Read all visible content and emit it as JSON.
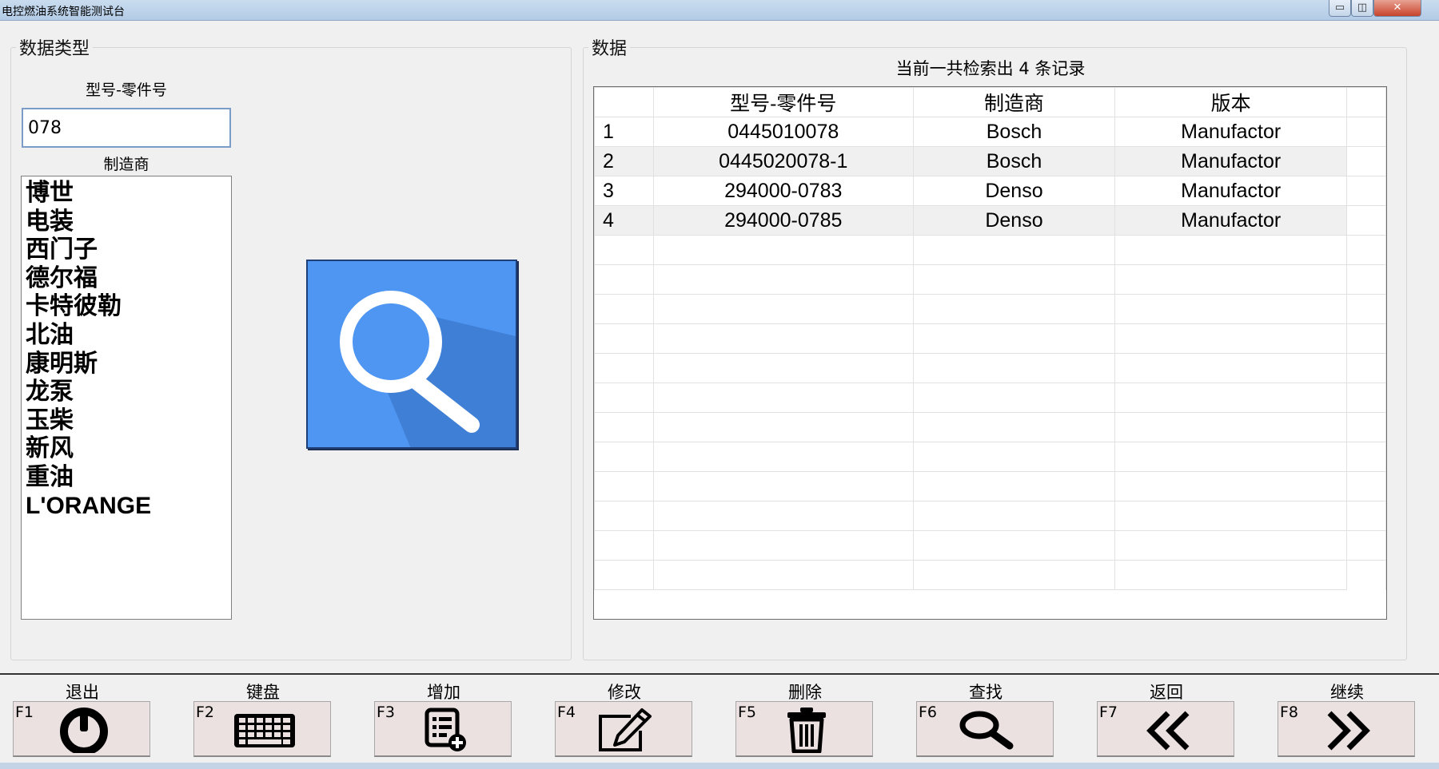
{
  "window": {
    "title": "电控燃油系统智能测试台",
    "min_label": "▭",
    "max_label": "◫",
    "close_label": "✕"
  },
  "left_panel": {
    "legend": "数据类型",
    "part_label": "型号-零件号",
    "part_value": "078",
    "manufacturer_label": "制造商",
    "manufacturers": [
      "博世",
      "电装",
      "西门子",
      "德尔福",
      "卡特彼勒",
      "北油",
      "康明斯",
      "龙泵",
      "玉柴",
      "新风",
      "重油",
      "L'ORANGE"
    ]
  },
  "search_button_icon": "search-icon",
  "right_panel": {
    "legend": "数据",
    "count_text": "当前一共检索出 4 条记录",
    "columns": [
      "",
      "型号-零件号",
      "制造商",
      "版本"
    ],
    "rows": [
      [
        "1",
        "0445010078",
        "Bosch",
        "Manufactor"
      ],
      [
        "2",
        "0445020078-1",
        "Bosch",
        "Manufactor"
      ],
      [
        "3",
        "294000-0783",
        "Denso",
        "Manufactor"
      ],
      [
        "4",
        "294000-0785",
        "Denso",
        "Manufactor"
      ]
    ]
  },
  "function_keys": [
    {
      "key": "F1",
      "label": "退出",
      "icon": "power-icon"
    },
    {
      "key": "F2",
      "label": "键盘",
      "icon": "keyboard-icon"
    },
    {
      "key": "F3",
      "label": "增加",
      "icon": "add-list-icon"
    },
    {
      "key": "F4",
      "label": "修改",
      "icon": "edit-icon"
    },
    {
      "key": "F5",
      "label": "删除",
      "icon": "trash-icon"
    },
    {
      "key": "F6",
      "label": "查找",
      "icon": "search-icon"
    },
    {
      "key": "F7",
      "label": "返回",
      "icon": "double-chevron-left-icon"
    },
    {
      "key": "F8",
      "label": "继续",
      "icon": "double-chevron-right-icon"
    }
  ]
}
